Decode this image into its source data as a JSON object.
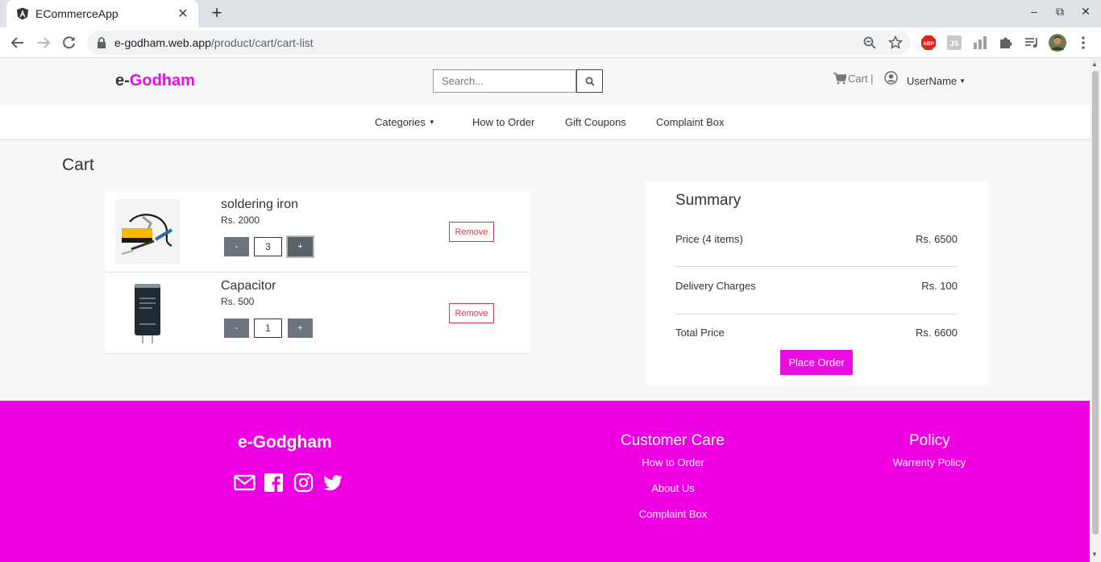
{
  "browser": {
    "tab_title": "ECommerceApp",
    "url_host": "e-godham.web.app",
    "url_path": "/product/cart/cart-list"
  },
  "header": {
    "logo_prefix": "e-",
    "logo_accent": "Godham",
    "search_placeholder": "Search...",
    "cart_label": "Cart |",
    "user_label": "UserName"
  },
  "nav": {
    "categories": "Categories",
    "how_to_order": "How to Order",
    "gift_coupons": "Gift Coupons",
    "complaint_box": "Complaint Box"
  },
  "page_title": "Cart",
  "cart_items": [
    {
      "name": "soldering iron",
      "price": "Rs. 2000",
      "quantity": "3",
      "minus": "-",
      "plus": "+",
      "remove": "Remove"
    },
    {
      "name": "Capacitor",
      "price": "Rs. 500",
      "quantity": "1",
      "minus": "-",
      "plus": "+",
      "remove": "Remove"
    }
  ],
  "summary": {
    "title": "Summary",
    "price_label": "Price (4 items)",
    "price_value": "Rs. 6500",
    "delivery_label": "Delivery Charges",
    "delivery_value": "Rs. 100",
    "total_label": "Total Price",
    "total_value": "Rs. 6600",
    "place_order": "Place Order"
  },
  "footer": {
    "brand": "e-Godgham",
    "customer_care_title": "Customer Care",
    "customer_care_links": [
      "How to Order",
      "About Us",
      "Complaint Box"
    ],
    "policy_title": "Policy",
    "policy_links": [
      "Warrenty Policy"
    ],
    "social_icons": [
      "envelope-icon",
      "facebook-icon",
      "instagram-icon",
      "twitter-icon"
    ]
  },
  "colors": {
    "brand": "#ea0ce0",
    "footer_bg": "#ef00e3",
    "remove": "#dc3545",
    "qty_button": "#6c757d"
  }
}
